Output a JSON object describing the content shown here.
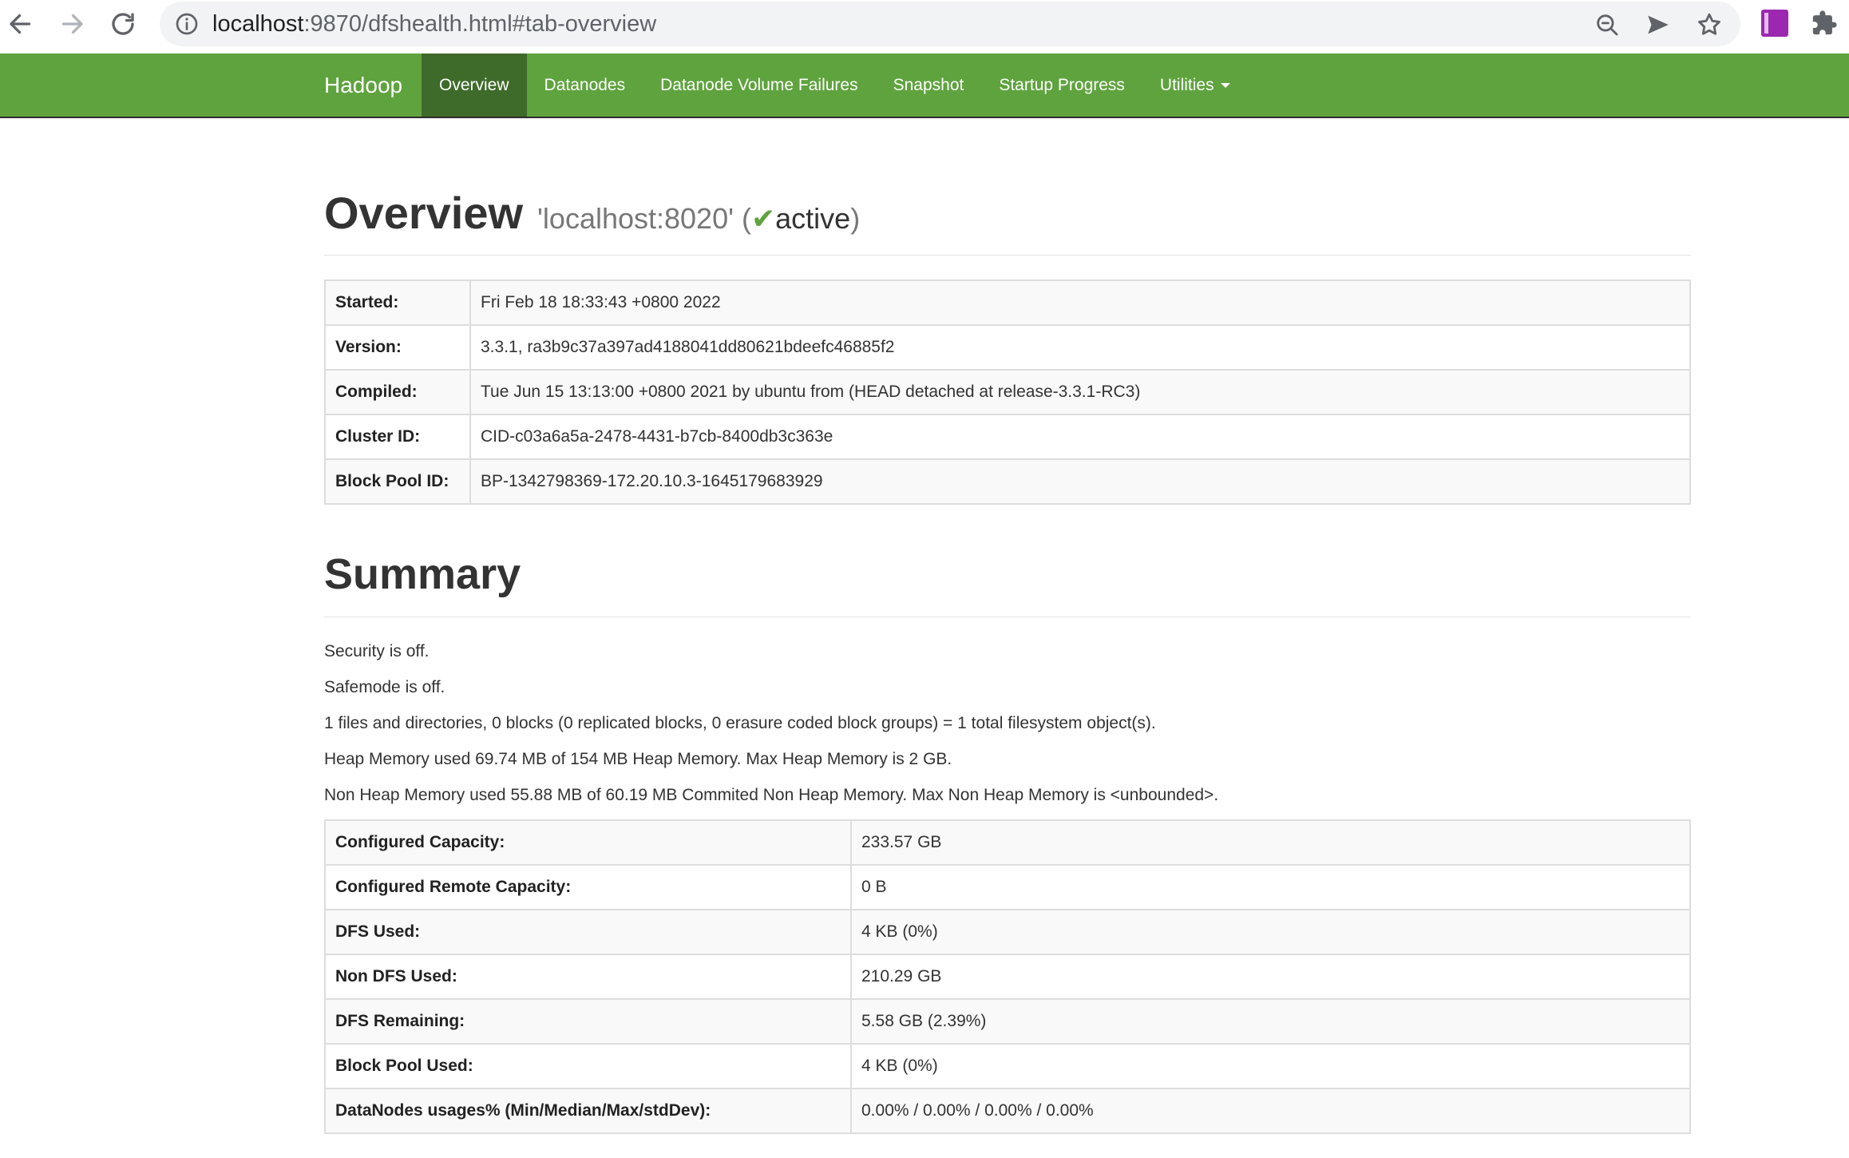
{
  "browser": {
    "url_host": "localhost",
    "url_rest": ":9870/dfshealth.html#tab-overview"
  },
  "navbar": {
    "brand": "Hadoop",
    "items": [
      {
        "label": "Overview",
        "active": true
      },
      {
        "label": "Datanodes",
        "active": false
      },
      {
        "label": "Datanode Volume Failures",
        "active": false
      },
      {
        "label": "Snapshot",
        "active": false
      },
      {
        "label": "Startup Progress",
        "active": false
      },
      {
        "label": "Utilities",
        "active": false
      }
    ],
    "color": "#5fa33e",
    "active_color": "#3f6b2a"
  },
  "overview": {
    "title": "Overview",
    "host": "'localhost:8020' (",
    "check": "✔",
    "state": "active",
    "close": ")",
    "rows": [
      {
        "key": "Started:",
        "value": "Fri Feb 18 18:33:43 +0800 2022"
      },
      {
        "key": "Version:",
        "value": "3.3.1, ra3b9c37a397ad4188041dd80621bdeefc46885f2"
      },
      {
        "key": "Compiled:",
        "value": "Tue Jun 15 13:13:00 +0800 2021 by ubuntu from (HEAD detached at release-3.3.1-RC3)"
      },
      {
        "key": "Cluster ID:",
        "value": "CID-c03a6a5a-2478-4431-b7cb-8400db3c363e"
      },
      {
        "key": "Block Pool ID:",
        "value": "BP-1342798369-172.20.10.3-1645179683929"
      }
    ]
  },
  "summary": {
    "title": "Summary",
    "lines": [
      "Security is off.",
      "Safemode is off.",
      "1 files and directories, 0 blocks (0 replicated blocks, 0 erasure coded block groups) = 1 total filesystem object(s).",
      "Heap Memory used 69.74 MB of 154 MB Heap Memory. Max Heap Memory is 2 GB.",
      "Non Heap Memory used 55.88 MB of 60.19 MB Commited Non Heap Memory. Max Non Heap Memory is <unbounded>."
    ],
    "rows": [
      {
        "key": "Configured Capacity:",
        "value": "233.57 GB"
      },
      {
        "key": "Configured Remote Capacity:",
        "value": "0 B"
      },
      {
        "key": "DFS Used:",
        "value": "4 KB (0%)"
      },
      {
        "key": "Non DFS Used:",
        "value": "210.29 GB"
      },
      {
        "key": "DFS Remaining:",
        "value": "5.58 GB (2.39%)"
      },
      {
        "key": "Block Pool Used:",
        "value": "4 KB (0%)"
      },
      {
        "key": "DataNodes usages% (Min/Median/Max/stdDev):",
        "value": "0.00% / 0.00% / 0.00% / 0.00%"
      }
    ]
  },
  "icons": {
    "back": "arrow-left-icon",
    "forward": "arrow-right-icon",
    "reload": "reload-icon",
    "info": "info-icon",
    "zoom": "zoom-icon",
    "send": "send-icon",
    "star": "star-icon",
    "extension_rp": "rp-extension-icon",
    "extensions": "puzzle-icon"
  }
}
